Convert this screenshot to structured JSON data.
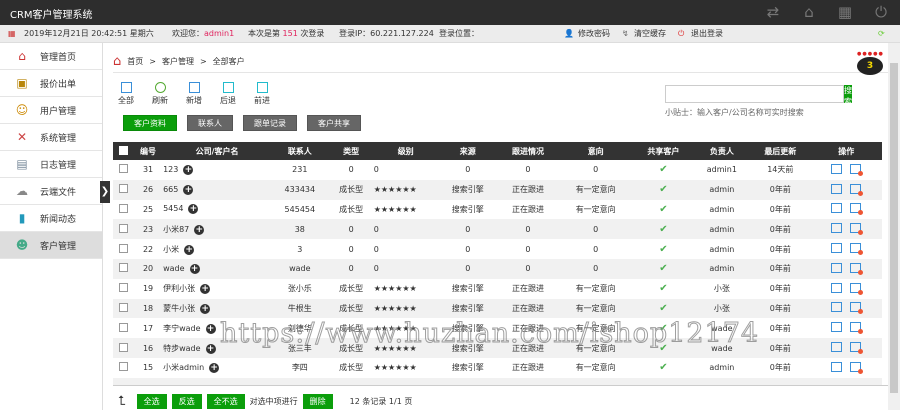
{
  "app": {
    "title": "CRM客户管理系统"
  },
  "top_icons": [
    "refresh-icon",
    "home-icon",
    "grid-icon",
    "power-icon"
  ],
  "infobar": {
    "datetime": "2019年12月21日 20:42:51 星期六",
    "welcome_label": "欢迎您：",
    "user": "admin1",
    "login_prefix": "本次是第",
    "login_count": "151",
    "login_suffix": "次登录",
    "ip": "登录IP：60.221.127.224",
    "location": "登录位置：",
    "change_pwd": "修改密码",
    "clear_cache": "清空缓存",
    "logout": "退出登录"
  },
  "sidebar": {
    "items": [
      {
        "label": "管理首页",
        "icon": "home-icon"
      },
      {
        "label": "报价出单",
        "icon": "contact-book-icon"
      },
      {
        "label": "用户管理",
        "icon": "users-icon"
      },
      {
        "label": "系统管理",
        "icon": "tools-icon"
      },
      {
        "label": "日志管理",
        "icon": "log-icon"
      },
      {
        "label": "云端文件",
        "icon": "cloud-icon"
      },
      {
        "label": "新闻动态",
        "icon": "book-icon"
      },
      {
        "label": "客户管理",
        "icon": "customer-icon"
      }
    ],
    "active": 7
  },
  "breadcrumb": [
    "首页",
    "客户管理",
    "全部客户"
  ],
  "toolbar": [
    "全部",
    "刷新",
    "新增",
    "后退",
    "前进"
  ],
  "tabs": [
    "客户资料",
    "联系人",
    "跟单记录",
    "客户共享"
  ],
  "search": {
    "button": "搜 索",
    "placeholder": "",
    "tip": "小贴士：输入客户/公司名称可实时搜索"
  },
  "notification": {
    "count": "3"
  },
  "table": {
    "headers": [
      "编号",
      "公司/客户名",
      "联系人",
      "类型",
      "级别",
      "来源",
      "跟进情况",
      "意向",
      "共享客户",
      "负责人",
      "最后更新",
      "操作"
    ],
    "rows": [
      [
        "31",
        "123",
        "231",
        "0",
        "0",
        "0",
        "0",
        "0",
        "admin1",
        "14天前"
      ],
      [
        "26",
        "665",
        "433434",
        "成长型",
        "★★★★★★",
        "搜索引擎",
        "正在跟进",
        "有一定意向",
        "admin",
        "0年前"
      ],
      [
        "25",
        "5454",
        "545454",
        "成长型",
        "★★★★★★",
        "搜索引擎",
        "正在跟进",
        "有一定意向",
        "admin",
        "0年前"
      ],
      [
        "23",
        "小米87",
        "38",
        "0",
        "0",
        "0",
        "0",
        "0",
        "admin",
        "0年前"
      ],
      [
        "22",
        "小米",
        "3",
        "0",
        "0",
        "0",
        "0",
        "0",
        "admin",
        "0年前"
      ],
      [
        "20",
        "wade",
        "wade",
        "0",
        "0",
        "0",
        "0",
        "0",
        "admin",
        "0年前"
      ],
      [
        "19",
        "伊利小张",
        "张小乐",
        "成长型",
        "★★★★★★",
        "搜索引擎",
        "正在跟进",
        "有一定意向",
        "小张",
        "0年前"
      ],
      [
        "18",
        "蒙牛小张",
        "牛根生",
        "成长型",
        "★★★★★★",
        "搜索引擎",
        "正在跟进",
        "有一定意向",
        "小张",
        "0年前"
      ],
      [
        "17",
        "李宁wade",
        "刘德华",
        "成长型",
        "★★★★★★",
        "搜索引擎",
        "正在跟进",
        "有一定意向",
        "wade",
        "0年前"
      ],
      [
        "16",
        "特步wade",
        "张三丰",
        "成长型",
        "★★★★★★",
        "搜索引擎",
        "正在跟进",
        "有一定意向",
        "wade",
        "0年前"
      ],
      [
        "15",
        "小米admin",
        "李四",
        "成长型",
        "★★★★★★",
        "搜索引擎",
        "正在跟进",
        "有一定意向",
        "admin",
        "0年前"
      ]
    ]
  },
  "footer": {
    "select_all": "全选",
    "invert": "反选",
    "select_none": "全不选",
    "action_label": "对选中项进行",
    "delete": "删除",
    "summary": "12 条记录 1/1 页"
  },
  "watermark": "https://www.huzhan.com/ishop12174",
  "colors": {
    "accent": "#0b9e0b",
    "header": "#2d2d2d",
    "highlight": "#e0245e"
  }
}
